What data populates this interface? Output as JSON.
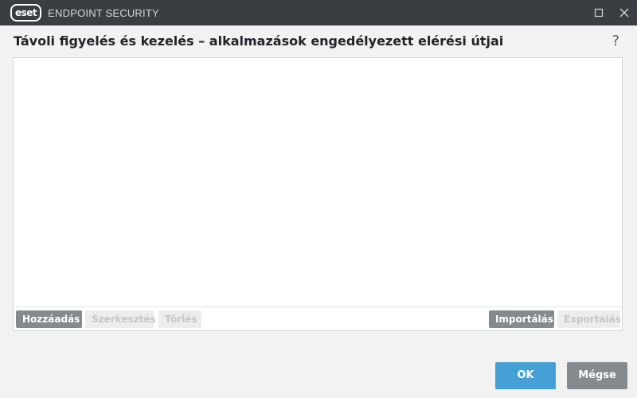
{
  "app": {
    "logo_text": "eset",
    "title": "ENDPOINT SECURITY"
  },
  "window_controls": {
    "maximize_icon": "maximize-icon",
    "close_icon": "close-icon"
  },
  "dialog": {
    "heading": "Távoli figyelés és kezelés – alkalmazások engedélyezett elérési útjai",
    "help_label": "?"
  },
  "list_toolbar": {
    "add_label": "Hozzáadás",
    "edit_label": "Szerkesztés",
    "delete_label": "Törlés",
    "import_label": "Importálás",
    "export_label": "Exportálás"
  },
  "footer": {
    "ok_label": "OK",
    "cancel_label": "Mégse"
  },
  "colors": {
    "titlebar": "#3a3d42",
    "primary_button": "#44a0d5",
    "secondary_button": "#858a8f"
  }
}
